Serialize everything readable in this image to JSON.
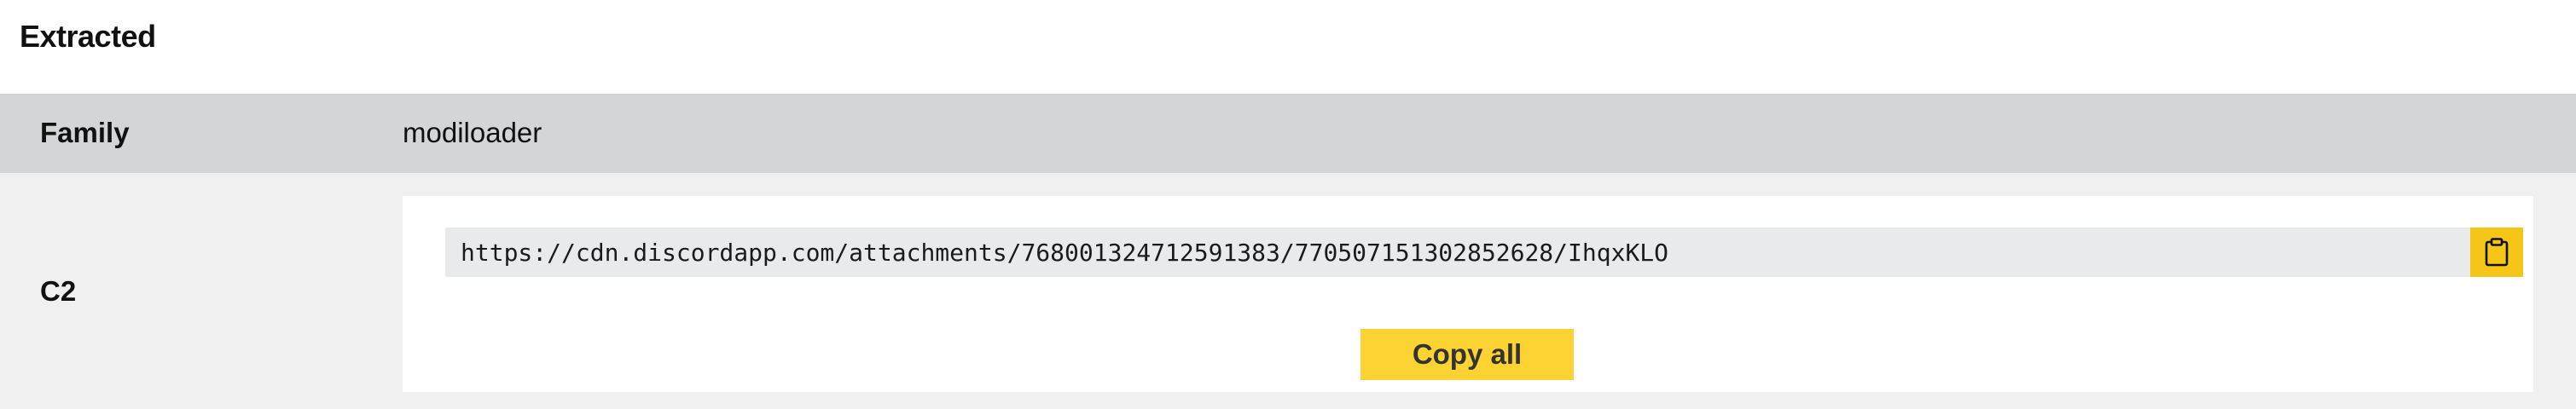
{
  "section": {
    "title": "Extracted"
  },
  "family": {
    "label": "Family",
    "value": "modiloader"
  },
  "c2": {
    "label": "C2",
    "url": "https://cdn.discordapp.com/attachments/768001324712591383/770507151302852628/IhqxKLO",
    "copy_icon": "clipboard-icon",
    "copy_all_label": "Copy all"
  },
  "colors": {
    "family_row_bg": "#d4d5d6",
    "c2_row_bg": "#f0f0f0",
    "url_box_bg": "#e9eaeb",
    "accent_yellow": "#fdd233",
    "clip_btn_yellow": "#f5c518"
  }
}
